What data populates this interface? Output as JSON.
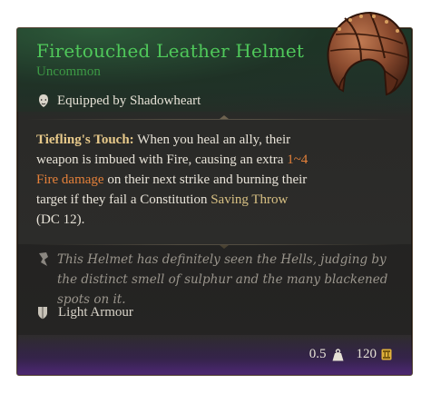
{
  "item": {
    "name": "Firetouched Leather Helmet",
    "rarity": "Uncommon",
    "equipped": "Equipped by Shadowheart",
    "passive": {
      "name": "Tiefling's Touch:",
      "text_part1": " When you heal an ally, their weapon is imbued with Fire, causing an extra ",
      "damage": "1~4 Fire damage",
      "text_part2": " on their next strike and burning their target if they fail a Constitution ",
      "saving_throw": "Saving Throw",
      "text_part3": " (DC 12)."
    },
    "lore": "This Helmet has definitely seen the Hells, judging by the distinct smell of sulphur and the many blackened spots on it.",
    "armour_type": "Light Armour",
    "weight": "0.5",
    "value": "120"
  },
  "colors": {
    "rarity_uncommon": "#4fc85a",
    "damage_fire": "#e5813a",
    "passive_name": "#e7c98a",
    "keyword": "#d8c083"
  },
  "icons": {
    "equipped": "character-portrait-icon",
    "lore": "quill-icon",
    "armour": "shield-icon",
    "weight": "weight-icon",
    "value": "gold-coin-icon",
    "item_image": "leather-helmet-icon"
  }
}
